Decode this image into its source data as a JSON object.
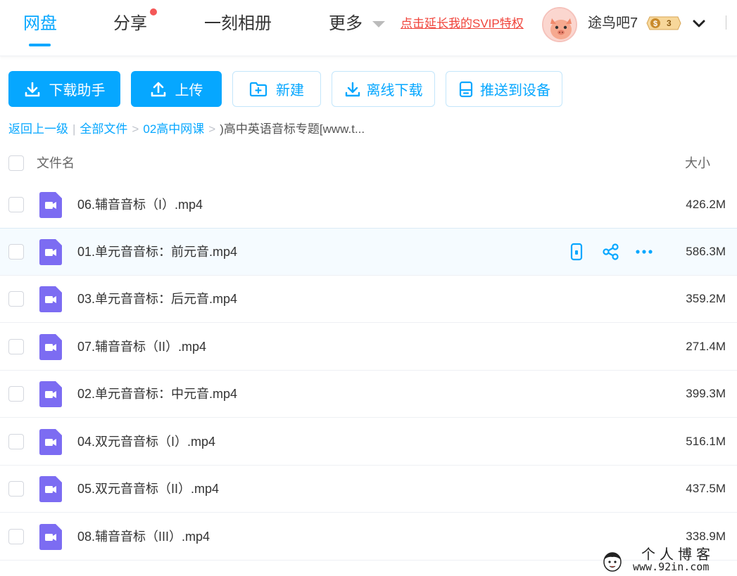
{
  "nav": {
    "tabs": [
      {
        "label": "网盘",
        "active": true
      },
      {
        "label": "分享",
        "has_dot": true
      },
      {
        "label": "一刻相册"
      },
      {
        "label": "更多",
        "has_dropdown": true
      }
    ],
    "svip_link": "点击延长我的SVIP特权",
    "username": "途鸟吧7",
    "level_badge": "3",
    "accent_color": "#06a7ff",
    "promo_color": "#f0433a"
  },
  "toolbar": {
    "download_helper": "下载助手",
    "upload": "上传",
    "new_folder": "新建",
    "offline_download": "离线下载",
    "push_to_device": "推送到设备"
  },
  "breadcrumb": {
    "back": "返回上一级",
    "all_files": "全部文件",
    "folder": "02高中网课",
    "current": ")高中英语音标专题[www.t..."
  },
  "list": {
    "header_name": "文件名",
    "header_size": "大小",
    "files": [
      {
        "name": "06.辅音音标（I）.mp4",
        "size": "426.2M"
      },
      {
        "name": "01.单元音音标：前元音.mp4",
        "size": "586.3M",
        "hovered": true
      },
      {
        "name": "03.单元音音标：后元音.mp4",
        "size": "359.2M"
      },
      {
        "name": "07.辅音音标（II）.mp4",
        "size": "271.4M"
      },
      {
        "name": "02.单元音音标：中元音.mp4",
        "size": "399.3M"
      },
      {
        "name": "04.双元音音标（I）.mp4",
        "size": "516.1M"
      },
      {
        "name": "05.双元音音标（II）.mp4",
        "size": "437.5M"
      },
      {
        "name": "08.辅音音标（III）.mp4",
        "size": "338.9M"
      }
    ]
  },
  "watermark": {
    "title": "个人博客",
    "url": "www.92in.com"
  }
}
